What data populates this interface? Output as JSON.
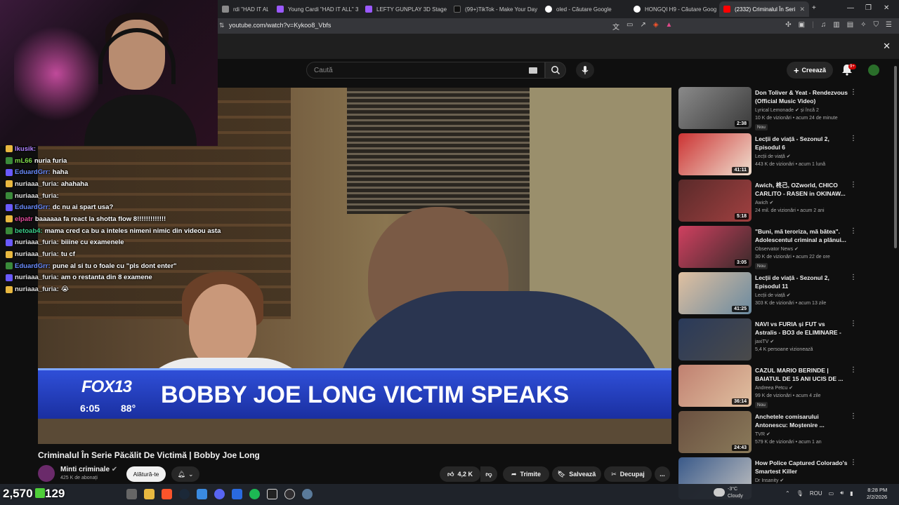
{
  "browser": {
    "tabs": [
      {
        "label": "rdi \"HAD IT ALL\" 3",
        "color": "#8a8a8a"
      },
      {
        "label": "Young Cardi \"HAD IT ALL\" 3",
        "color": "#9b59ff"
      },
      {
        "label": "LEFTY GUNPLAY 3D Stage V",
        "color": "#9b59ff"
      },
      {
        "label": "(99+)TikTok - Make Your Day",
        "color": "#111111"
      },
      {
        "label": "oled - Căutare Google",
        "color": "#ffffff"
      },
      {
        "label": "HONGQI H9 - Căutare Goog",
        "color": "#ffffff"
      },
      {
        "label": "(2332) Criminalul În Seri",
        "color": "#ff0000"
      }
    ],
    "url": "youtube.com/watch?v=Kykoo8_Vbfs"
  },
  "youtube": {
    "search_placeholder": "Caută",
    "create_label": "Creează",
    "notif_count": "9+"
  },
  "video": {
    "chyron_logo": "FOX13",
    "chyron_time": "6:05",
    "chyron_temp": "88°",
    "chyron_headline": "BOBBY JOE LONG VICTIM SPEAKS",
    "title": "Criminalul În Serie Păcălit De Victimă | Bobby Joe Long",
    "channel_name": "Minti criminale",
    "channel_subs": "425 K de abonați",
    "join_label": "Alătură-te",
    "likes": "4,2 K",
    "share_label": "Trimite",
    "save_label": "Salvează",
    "clip_label": "Decupaj",
    "more": "..."
  },
  "chat": [
    {
      "user": "lkusik:",
      "msg": "",
      "color": "#b080ff"
    },
    {
      "user": "mL66",
      "msg": "nuria furia",
      "color": "#7fdc4a"
    },
    {
      "user": "EduardGrr:",
      "msg": "haha",
      "color": "#6a8cff"
    },
    {
      "user": "nuriaaa_furia:",
      "msg": "ahahaha",
      "color": "#e0e0e0"
    },
    {
      "user": "nuriaaa_furia:",
      "msg": "",
      "color": "#e0e0e0"
    },
    {
      "user": "EduardGrr:",
      "msg": "dc nu ai spart usa?",
      "color": "#6a8cff"
    },
    {
      "user": "elpatr",
      "msg": "baaaaaa fa react la shotta flow 8!!!!!!!!!!!!!",
      "color": "#e04a9a"
    },
    {
      "user": "betoab4:",
      "msg": "mama cred ca bu a inteles nimeni nimic din videou asta",
      "color": "#3acf8a"
    },
    {
      "user": "nuriaaa_furia:",
      "msg": "biiine cu examenele",
      "color": "#e0e0e0"
    },
    {
      "user": "nuriaaa_furia:",
      "msg": "tu cf",
      "color": "#e0e0e0"
    },
    {
      "user": "EduardGrr:",
      "msg": "pune al si tu o foale cu \"pls dont enter\"",
      "color": "#6a8cff"
    },
    {
      "user": "nuriaaa_furia:",
      "msg": "am o restanta din 8 examene",
      "color": "#e0e0e0"
    },
    {
      "user": "nuriaaa_furia:",
      "msg": "😭",
      "color": "#e0e0e0"
    }
  ],
  "recommendations": [
    {
      "title": "Don Toliver & Yeat - Rendezvous (Official Music Video)",
      "channel": "Lyrical Lemonade",
      "channel_suffix": "și încă 2",
      "meta": "10 K de vizionări • acum 24 de minute",
      "badge": "Nou",
      "duration": "2:38",
      "colors": [
        "#8a8a8a",
        "#3a3a3a"
      ]
    },
    {
      "title": "Lecții de viață - Sezonul 2, Episodul 6",
      "channel": "Lecții de viață",
      "meta": "443 K de vizionări • acum 1 lună",
      "badge": "",
      "duration": "41:11",
      "colors": [
        "#cc3333",
        "#f0e0d0"
      ]
    },
    {
      "title": "Awich, 柊己, OZworld, CHICO CARLITO - RASEN in OKINAW...",
      "channel": "Awich",
      "meta": "24 mil. de vizionări • acum 2 ani",
      "badge": "",
      "duration": "5:18",
      "colors": [
        "#5a2a2a",
        "#a04040"
      ]
    },
    {
      "title": "\"Buni, mă terorizа, mă bătea\". Adolescentul criminal a plănui...",
      "channel": "Observator News",
      "meta": "30 K de vizionări • acum 22 de ore",
      "badge": "Nou",
      "duration": "3:05",
      "colors": [
        "#d04060",
        "#3a2a2a"
      ]
    },
    {
      "title": "Lecții de viață - Sezonul 2, Episodul 11",
      "channel": "Lecții de viață",
      "meta": "303 K de vizionări • acum 13 zile",
      "badge": "",
      "duration": "41:25",
      "colors": [
        "#e0c0a0",
        "#6a8aa0"
      ]
    },
    {
      "title": "NAVI vs FURIA și FUT vs Astralis - BO3 de ELIMINARE - ...",
      "channel": "jaxiTV",
      "meta": "5,4 K persoane vizionează",
      "badge": "",
      "duration": "",
      "colors": [
        "#2a3a5a",
        "#4a4a4a"
      ]
    },
    {
      "title": "CAZUL MARIO BERINDE | BAIATUL DE 15 ANI UCIS DE ...",
      "channel": "Andreea Petcu",
      "meta": "99 K de vizionări • acum 4 zile",
      "badge": "Nou",
      "duration": "36:14",
      "colors": [
        "#c08070",
        "#e0c0a0"
      ]
    },
    {
      "title": "Anchetele comisarului Antonescu: Moștenire ...",
      "channel": "TVR",
      "meta": "579 K de vizionări • acum 1 an",
      "badge": "",
      "duration": "24:43",
      "colors": [
        "#6a5040",
        "#8a7a5a"
      ]
    },
    {
      "title": "How Police Captured Colorado's Smartest Killer",
      "channel": "Dr Insanity",
      "meta": "",
      "badge": "",
      "duration": "",
      "colors": [
        "#3a5a8a",
        "#c0c0c0"
      ]
    }
  ],
  "taskbar": {
    "counter_left": "2,570",
    "counter_right": "129",
    "weather_temp": "-3°C",
    "weather_cond": "Cloudy",
    "lang": "ROU",
    "time": "8:28 PM",
    "date": "2/2/2026"
  }
}
